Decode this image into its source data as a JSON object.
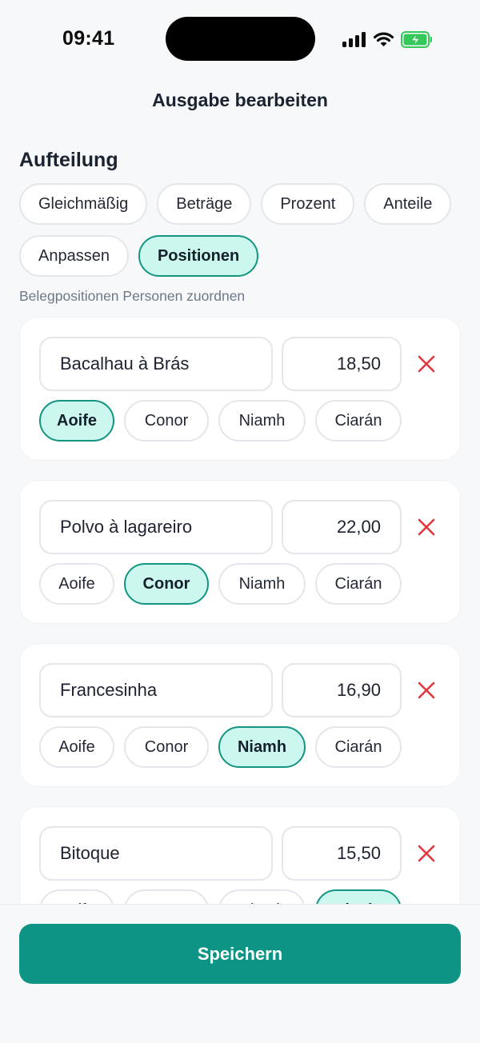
{
  "status_bar": {
    "time": "09:41"
  },
  "header": {
    "title": "Ausgabe bearbeiten"
  },
  "split": {
    "title": "Aufteilung",
    "modes": [
      {
        "label": "Gleichmäßig",
        "active": false
      },
      {
        "label": "Beträge",
        "active": false
      },
      {
        "label": "Prozent",
        "active": false
      },
      {
        "label": "Anteile",
        "active": false
      },
      {
        "label": "Anpassen",
        "active": false
      },
      {
        "label": "Positionen",
        "active": true
      }
    ],
    "hint": "Belegpositionen Personen zuordnen"
  },
  "items": [
    {
      "name": "Bacalhau à Brás",
      "amount": "18,50",
      "people": [
        "Aoife",
        "Conor",
        "Niamh",
        "Ciarán"
      ],
      "selected": "Aoife"
    },
    {
      "name": "Polvo à lagareiro",
      "amount": "22,00",
      "people": [
        "Aoife",
        "Conor",
        "Niamh",
        "Ciarán"
      ],
      "selected": "Conor"
    },
    {
      "name": "Francesinha",
      "amount": "16,90",
      "people": [
        "Aoife",
        "Conor",
        "Niamh",
        "Ciarán"
      ],
      "selected": "Niamh"
    },
    {
      "name": "Bitoque",
      "amount": "15,50",
      "people": [
        "Aoife",
        "Conor",
        "Niamh",
        "Ciarán"
      ],
      "selected": "Ciarán"
    }
  ],
  "footer": {
    "save_label": "Speichern"
  },
  "colors": {
    "accent": "#0e9484",
    "chip_selected_bg": "#ccf7ee",
    "remove": "#e0383e"
  }
}
